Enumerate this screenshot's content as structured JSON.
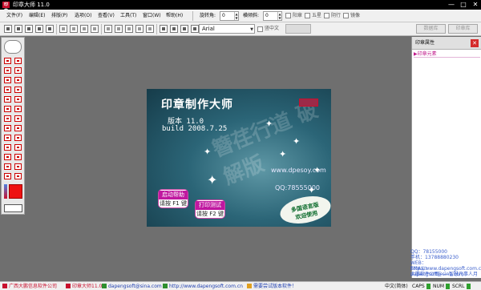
{
  "app": {
    "title": "印章大师 11.0",
    "logo_text": "印章"
  },
  "window_buttons": {
    "min": "—",
    "max": "□",
    "close": "✕"
  },
  "menu": [
    "文件(F)",
    "编辑(E)",
    "排版(P)",
    "选项(O)",
    "查看(V)",
    "工具(T)",
    "窗口(W)",
    "帮助(H)"
  ],
  "props": {
    "rotate_label": "旋转角:",
    "rotate_value": "0",
    "tilt_label": "横倾斜:",
    "tilt_value": "0",
    "options": [
      "阳章",
      "五星",
      "阴行",
      "镜像"
    ]
  },
  "font": {
    "value": "Arial",
    "vertical_label": "竖中文"
  },
  "tabs": {
    "data": "数据库",
    "seal": "印章库"
  },
  "splash": {
    "title": "印章制作大师",
    "watermark": "簪荏行道 破解版",
    "version": "版本 11.0",
    "build": "build 2008.7.25",
    "site": "www.dpesoy.com",
    "qq": "QQ:78555000",
    "help_title": "启动帮助",
    "help_key": "请按 F1 键",
    "print_title": "打印测试",
    "print_key": "请按 F2 键",
    "oval_line1": "多国语言版",
    "oval_line2": "欢迎使用"
  },
  "right_panel": {
    "title": "印章属性",
    "section": "▶印章元素",
    "close": "✕"
  },
  "info": {
    "qq": "QQ：78155000",
    "phone": "手机：13788880230",
    "web": "WEB：http://www.dapengsoft.com.cn",
    "email": "EMAIL：dapengsoft@sina.com",
    "company": "大鹏软件公司——智慧凡事人月"
  },
  "status": {
    "company": "广西大鹏信息软件公司",
    "version": "印章大师11.0",
    "email": "dapengsoft@sina.com",
    "web": "http://www.dapengsoft.com.cn",
    "tip": "需要尝试版本软件！",
    "lang": "中文(简体)",
    "caps": "CAPS",
    "num": "NUM",
    "scrl": "SCRL"
  },
  "colors": {
    "accent_red": "#c8102e",
    "canvas_bg": "#6f6f6f",
    "link_blue": "#3b5fcc",
    "magenta": "#c0188a"
  },
  "icons": [
    "open-icon",
    "save-icon",
    "print-icon",
    "cut-icon",
    "copy-icon",
    "paste-icon",
    "delete-icon",
    "font-icon",
    "color-icon",
    "palette-shape-icons",
    "red-square-swatch"
  ]
}
